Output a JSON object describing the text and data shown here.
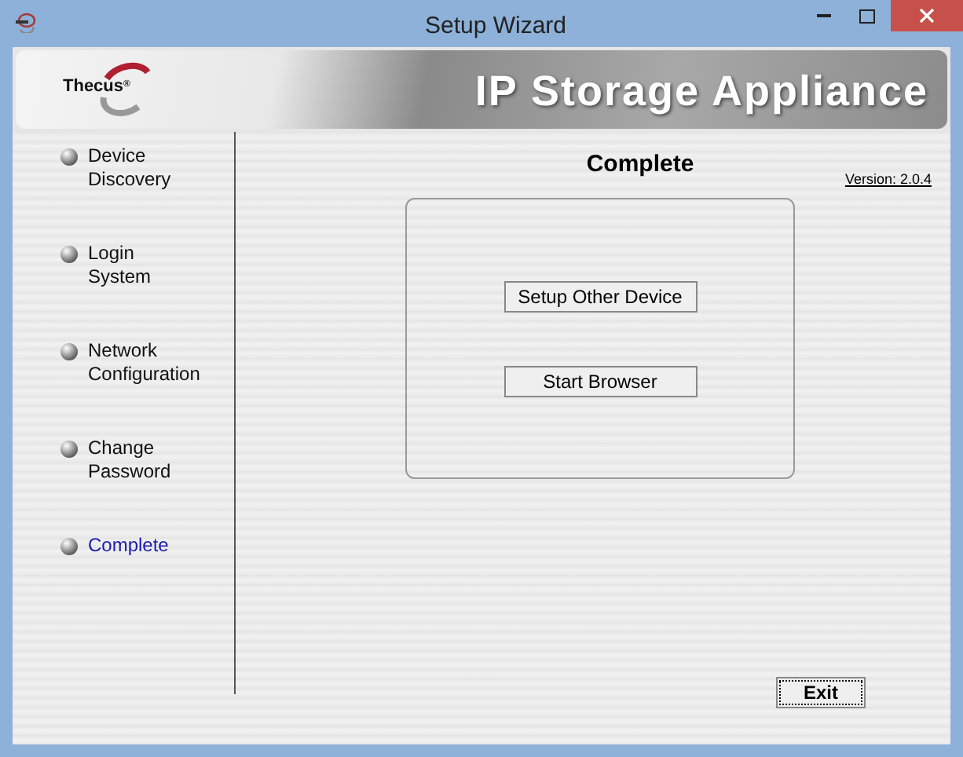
{
  "window": {
    "title": "Setup Wizard"
  },
  "banner": {
    "logo": "Thecus",
    "logo_mark": "®",
    "title": "IP Storage Appliance"
  },
  "steps": [
    {
      "lines": [
        "Device",
        "Discovery"
      ],
      "selected": false
    },
    {
      "lines": [
        "Login",
        "System"
      ],
      "selected": false
    },
    {
      "lines": [
        "Network",
        "Configuration"
      ],
      "selected": false
    },
    {
      "lines": [
        "Change",
        "Password"
      ],
      "selected": false
    },
    {
      "lines": [
        "Complete"
      ],
      "selected": true
    }
  ],
  "page": {
    "title": "Complete",
    "version": "Version: 2.0.4"
  },
  "actions": [
    "Setup Other Device",
    "Start Browser"
  ],
  "exit_button": "Exit"
}
